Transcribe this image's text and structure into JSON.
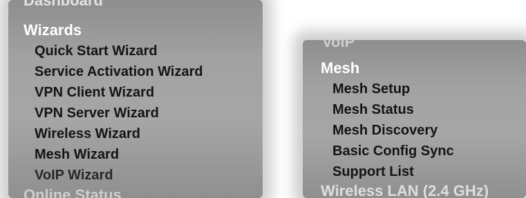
{
  "left_panel": {
    "prev_section": "Dashboard",
    "section_title": "Wizards",
    "items": [
      {
        "label": "Quick Start Wizard"
      },
      {
        "label": "Service Activation Wizard"
      },
      {
        "label": "VPN Client Wizard"
      },
      {
        "label": "VPN Server Wizard"
      },
      {
        "label": "Wireless Wizard"
      },
      {
        "label": "Mesh Wizard"
      },
      {
        "label": "VoIP Wizard"
      }
    ],
    "next_section": "Online Status"
  },
  "right_panel": {
    "prev_section": "VoIP",
    "section_title": "Mesh",
    "items": [
      {
        "label": "Mesh Setup"
      },
      {
        "label": "Mesh Status"
      },
      {
        "label": "Mesh Discovery"
      },
      {
        "label": "Basic Config Sync"
      },
      {
        "label": "Support List"
      }
    ],
    "next_section": "Wireless LAN (2.4 GHz)"
  }
}
